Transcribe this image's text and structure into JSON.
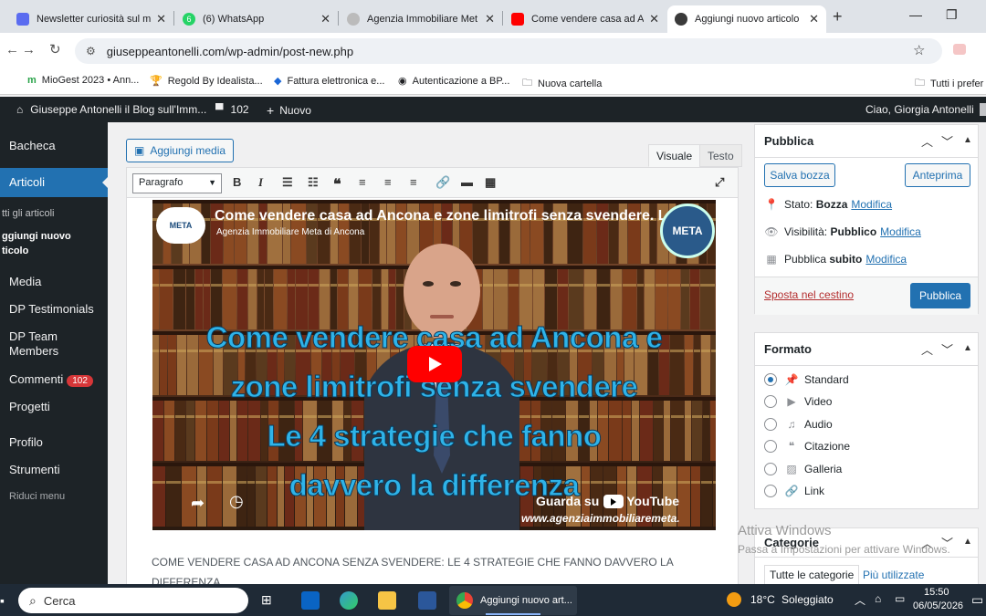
{
  "browser": {
    "tabs": [
      {
        "title": "Newsletter curiosità sul m",
        "color": "#5b6cf0"
      },
      {
        "title": "(6) WhatsApp",
        "color": "#25d366"
      },
      {
        "title": "Agenzia Immobiliare Met",
        "color": "#888888"
      },
      {
        "title": "Come vendere casa ad An",
        "color": "#ff0000"
      },
      {
        "title": "Aggiungi nuovo articolo",
        "color": "#3a3a3a"
      }
    ],
    "new_tab": "+",
    "url": "giuseppeantonelli.com/wp-admin/post-new.php",
    "bookmarks": [
      {
        "label": "MioGest 2023 • Ann...",
        "icon": "m"
      },
      {
        "label": "Regold By Idealista...",
        "icon": "🏆"
      },
      {
        "label": "Fattura elettronica e...",
        "icon": "◆"
      },
      {
        "label": "Autenticazione a BP...",
        "icon": "🌐"
      },
      {
        "label": "Nuova cartella",
        "icon": "🗀"
      }
    ],
    "bookmarks_right": "Tutti i prefer"
  },
  "adminbar": {
    "site": "Giuseppe Antonelli il Blog sull'Imm...",
    "comments": "102",
    "new": "Nuovo",
    "greeting": "Ciao, Giorgia Antonelli"
  },
  "sidebar": {
    "bacheca": "Bacheca",
    "articoli": "Articoli",
    "sub_all": "tti gli articoli",
    "sub_new_1": "ggiungi nuovo",
    "sub_new_2": "ticolo",
    "media": "Media",
    "testimonials": "DP Testimonials",
    "team_1": "DP Team",
    "team_2": "Members",
    "commenti": "Commenti",
    "commenti_badge": "102",
    "progetti": "Progetti",
    "profilo": "Profilo",
    "strumenti": "Strumenti",
    "riduci": "Riduci menu"
  },
  "editor": {
    "add_media": "Aggiungi media",
    "tab_visual": "Visuale",
    "tab_text": "Testo",
    "format": "Paragrafo",
    "video": {
      "title": "Come vendere casa ad Ancona e zone limitrofi senza svendere. L",
      "channel": "Agenzia Immobiliare Meta di Ancona",
      "logo_left": "META",
      "logo_right": "META",
      "line1": "Come vendere casa ad Ancona e",
      "line2": "zone limitrofi senza svendere",
      "line3": "Le 4 strategie che fanno",
      "line4": "davvero la differenza",
      "watch_on": "Guarda su",
      "youtube": "YouTube",
      "url": "www.agenziaimmobiliaremeta."
    },
    "body": "COME VENDERE CASA AD ANCONA SENZA SVENDERE: LE 4 STRATEGIE CHE FANNO DAVVERO LA DIFFERENZA."
  },
  "publish": {
    "title": "Pubblica",
    "save_draft": "Salva bozza",
    "preview": "Anteprima",
    "status_label": "Stato:",
    "status_value": "Bozza",
    "visibility_label": "Visibilità:",
    "visibility_value": "Pubblico",
    "schedule_label": "Pubblica",
    "schedule_value": "subito",
    "edit": "Modifica",
    "trash": "Sposta nel cestino",
    "publish_btn": "Pubblica"
  },
  "format": {
    "title": "Formato",
    "options": [
      "Standard",
      "Video",
      "Audio",
      "Citazione",
      "Galleria",
      "Link"
    ],
    "selected": "Standard"
  },
  "categories": {
    "title": "Categorie",
    "tab_all": "Tutte le categorie",
    "tab_used": "Più utilizzate"
  },
  "watermark": {
    "line1": "Attiva Windows",
    "line2": "Passa a Impostazioni per attivare Windows."
  },
  "taskbar": {
    "search": "Cerca",
    "chrome_task": "Aggiungi nuovo art...",
    "weather_temp": "18°C",
    "weather_text": "Soleggiato",
    "time": "15:50",
    "date": "06/05/2026"
  }
}
